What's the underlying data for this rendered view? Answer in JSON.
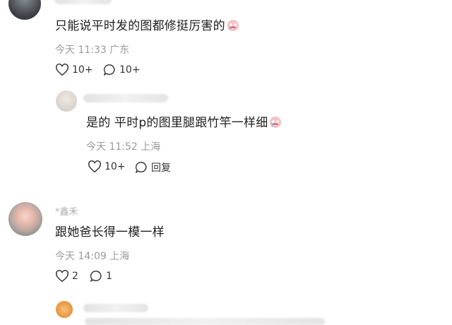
{
  "comments": [
    {
      "text": "只能说平时发的图都修挺厉害的",
      "emoji": "crying-face-icon",
      "time": "今天 11:33",
      "location": "广东",
      "likes": "10+",
      "replies": "10+"
    },
    {
      "text": "是的 平时p的图里腿跟竹竿一样细",
      "emoji": "crying-face-icon",
      "time": "今天 11:52",
      "location": "上海",
      "likes": "10+",
      "reply_label": "回复"
    },
    {
      "username": "*鑫禾",
      "text": "跟她爸长得一模一样",
      "time": "今天 14:09",
      "location": "上海",
      "likes": "2",
      "replies": "1"
    }
  ],
  "colors": {
    "meta": "#9a9a9a",
    "text": "#1f1f1f",
    "background": "#ffffff"
  }
}
